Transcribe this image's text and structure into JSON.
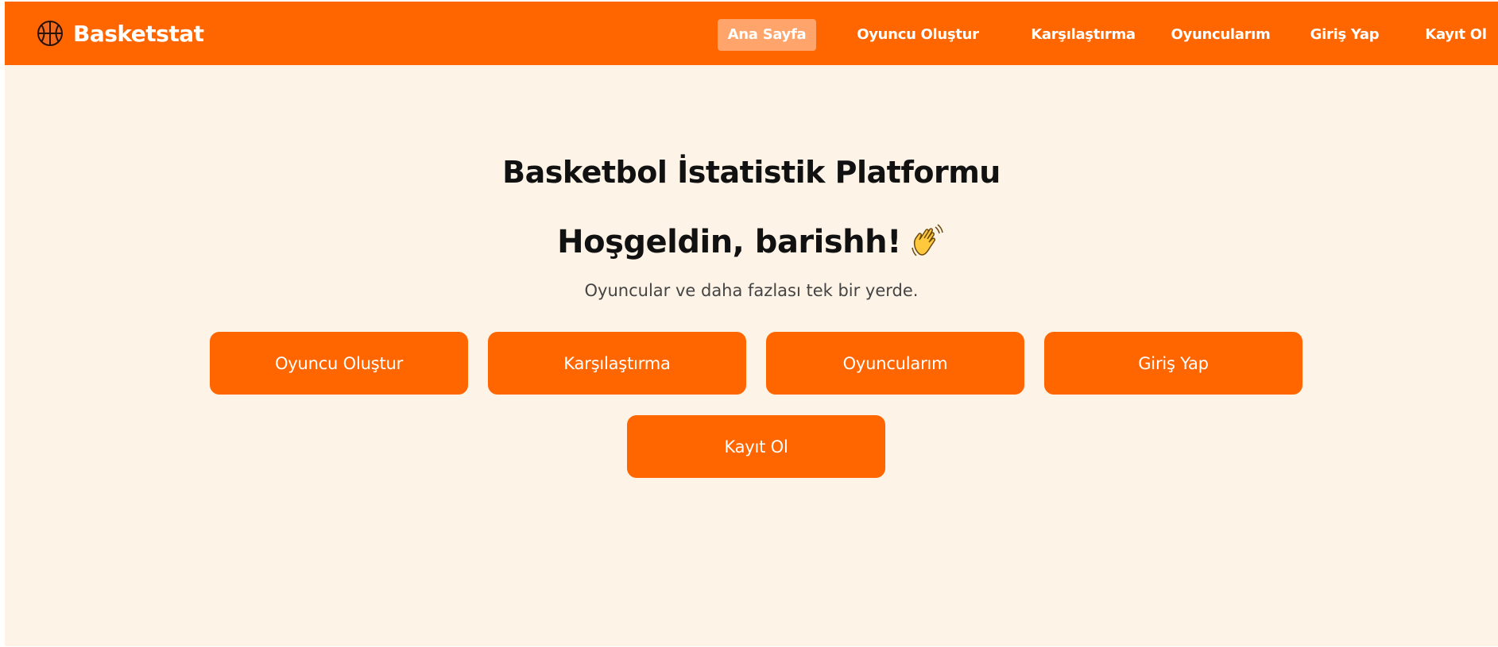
{
  "colors": {
    "brand": "#ff6600",
    "page_background": "#fdf3e6",
    "nav_active_background": "#ffa46a",
    "text_primary": "#111111",
    "text_secondary": "#444444",
    "button_text": "#ffffff"
  },
  "navbar": {
    "brand": {
      "icon": "basketball-icon",
      "name": "Basketstat"
    },
    "links": [
      {
        "label": "Ana Sayfa",
        "active": true
      },
      {
        "label": "Oyuncu Oluştur",
        "active": false
      },
      {
        "label": "Karşılaştırma",
        "active": false
      },
      {
        "label": "Oyuncularım",
        "active": false
      },
      {
        "label": "Giriş Yap",
        "active": false
      },
      {
        "label": "Kayıt Ol",
        "active": false
      }
    ]
  },
  "main": {
    "title": "Basketbol İstatistik Platformu",
    "greeting": "Hoşgeldin, barishh!",
    "greeting_icon": "waving-hand-icon",
    "subtitle": "Oyuncular ve daha fazlası tek bir yerde.",
    "buttons": [
      {
        "label": "Oyuncu Oluştur"
      },
      {
        "label": "Karşılaştırma"
      },
      {
        "label": "Oyuncularım"
      },
      {
        "label": "Giriş Yap"
      },
      {
        "label": "Kayıt Ol"
      }
    ]
  }
}
